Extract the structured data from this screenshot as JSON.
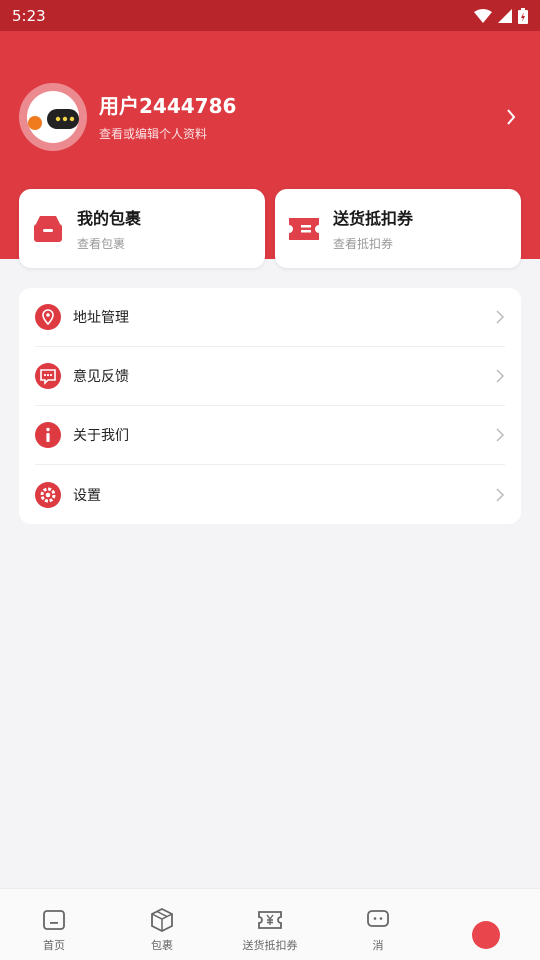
{
  "status_bar": {
    "time": "5:23"
  },
  "profile": {
    "username": "用户2444786",
    "subtitle": "查看或编辑个人资料"
  },
  "cards": [
    {
      "title": "我的包裹",
      "subtitle": "查看包裹",
      "icon": "package-box-icon"
    },
    {
      "title": "送货抵扣券",
      "subtitle": "查看抵扣券",
      "icon": "coupon-ticket-icon"
    }
  ],
  "menu": [
    {
      "label": "地址管理",
      "icon": "location-pin-icon"
    },
    {
      "label": "意见反馈",
      "icon": "feedback-message-icon"
    },
    {
      "label": "关于我们",
      "icon": "info-icon"
    },
    {
      "label": "设置",
      "icon": "gear-icon"
    }
  ],
  "tabbar": [
    {
      "label": "首页",
      "icon": "home-icon"
    },
    {
      "label": "包裹",
      "icon": "package-icon"
    },
    {
      "label": "送货抵扣券",
      "icon": "coupon-icon"
    },
    {
      "label": "消",
      "icon": "message-icon"
    }
  ],
  "colors": {
    "brand_red": "#dd3a42",
    "status_bar": "#b8262c",
    "background": "#f4f4f6"
  }
}
